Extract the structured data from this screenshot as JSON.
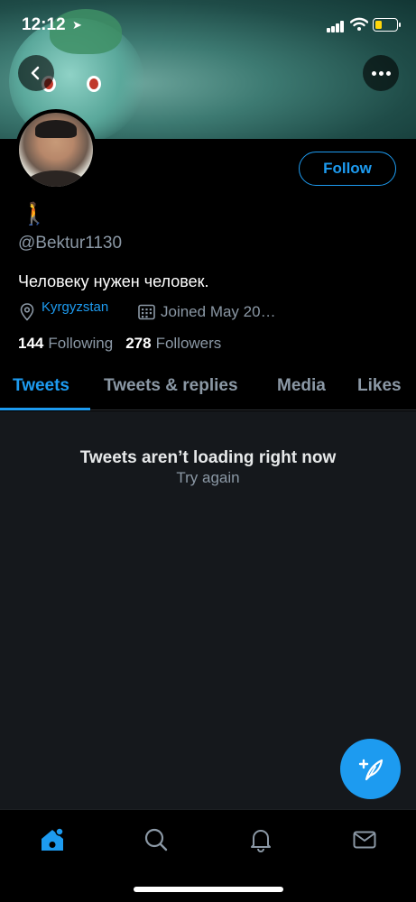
{
  "status_bar": {
    "time": "12:12"
  },
  "profile": {
    "emoji": "🚶",
    "handle": "@Bektur1130",
    "bio": "Человеку нужен человек.",
    "location": "Kyrgyzstan",
    "joined": "Joined May 20…",
    "following_count": "144",
    "following_label": "Following",
    "followers_count": "278",
    "followers_label": "Followers"
  },
  "follow_button": {
    "label": "Follow"
  },
  "tabs": [
    {
      "label": "Tweets",
      "active": true
    },
    {
      "label": "Tweets & replies",
      "active": false
    },
    {
      "label": "Media",
      "active": false
    },
    {
      "label": "Likes",
      "active": false
    }
  ],
  "feed": {
    "error_title": "Tweets aren’t loading right now",
    "retry_label": "Try again"
  },
  "bottom_nav": [
    {
      "icon": "home-icon",
      "active": true
    },
    {
      "icon": "search-icon",
      "active": false
    },
    {
      "icon": "bell-icon",
      "active": false
    },
    {
      "icon": "mail-icon",
      "active": false
    }
  ],
  "colors": {
    "accent": "#1d9bf0",
    "background": "#000000",
    "feed_background": "#15181c",
    "secondary_text": "#8b98a5"
  }
}
